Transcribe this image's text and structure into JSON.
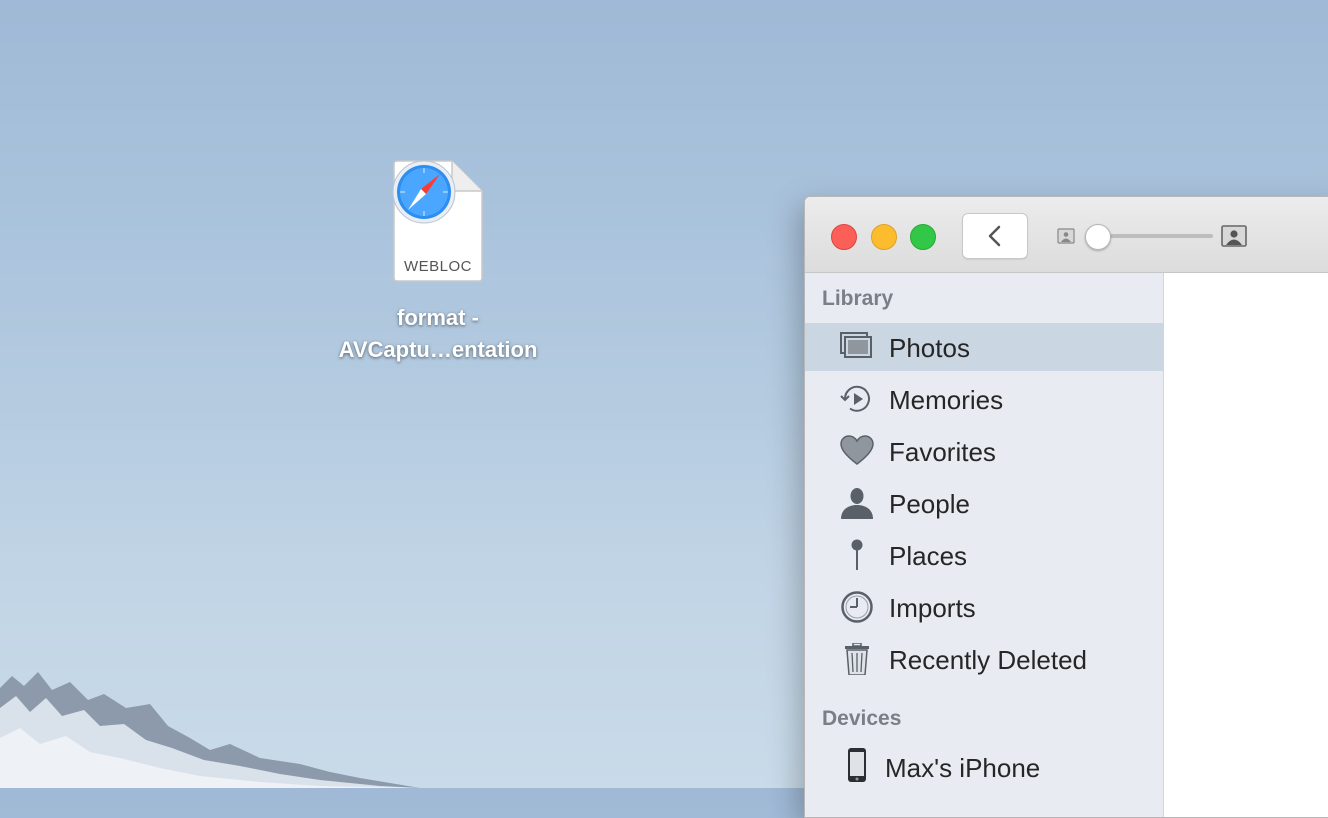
{
  "desktop": {
    "file": {
      "badge": "WEBLOC",
      "name_line1": "format -",
      "name_line2": "AVCaptu…entation",
      "icon": "safari-compass-icon"
    }
  },
  "window": {
    "toolbar": {
      "back_icon": "chevron-left-icon",
      "zoom_level": 0
    },
    "sidebar": {
      "library_header": "Library",
      "library_items": [
        {
          "label": "Photos",
          "icon": "photos-stack-icon",
          "selected": true
        },
        {
          "label": "Memories",
          "icon": "memories-icon"
        },
        {
          "label": "Favorites",
          "icon": "heart-icon"
        },
        {
          "label": "People",
          "icon": "person-icon"
        },
        {
          "label": "Places",
          "icon": "pin-icon"
        },
        {
          "label": "Imports",
          "icon": "clock-icon"
        },
        {
          "label": "Recently Deleted",
          "icon": "trash-icon"
        }
      ],
      "devices_header": "Devices",
      "device_items": [
        {
          "label": "Max's iPhone",
          "icon": "iphone-icon"
        }
      ]
    }
  }
}
